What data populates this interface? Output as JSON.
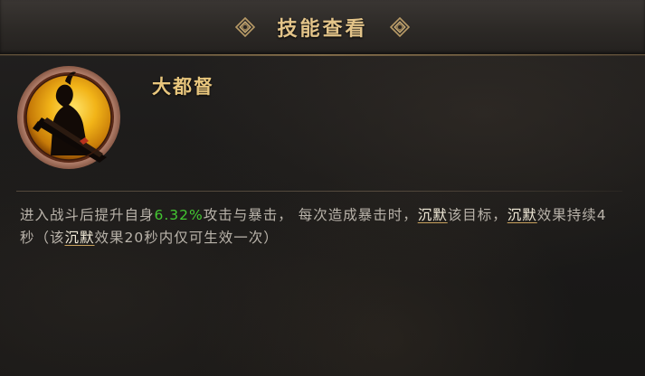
{
  "header": {
    "title": "技能查看"
  },
  "skill": {
    "name": "大都督",
    "icon": "general-silhouette-icon",
    "desc": {
      "p1": "进入战斗后提升自身",
      "value": "6.32%",
      "p2": "攻击与暴击，  每次造成暴击时，",
      "kw1": "沉默",
      "p3": "该目标，",
      "kw2": "沉默",
      "p4": "效果持续4秒（该",
      "kw3": "沉默",
      "p5": "效果20秒内仅可生效一次）"
    }
  },
  "colors": {
    "title_gold": "#e3c489",
    "name_gold": "#e8c67d",
    "value_green": "#43c832",
    "keyword_white": "#f1ead8",
    "body_text": "#b9b3aa"
  }
}
